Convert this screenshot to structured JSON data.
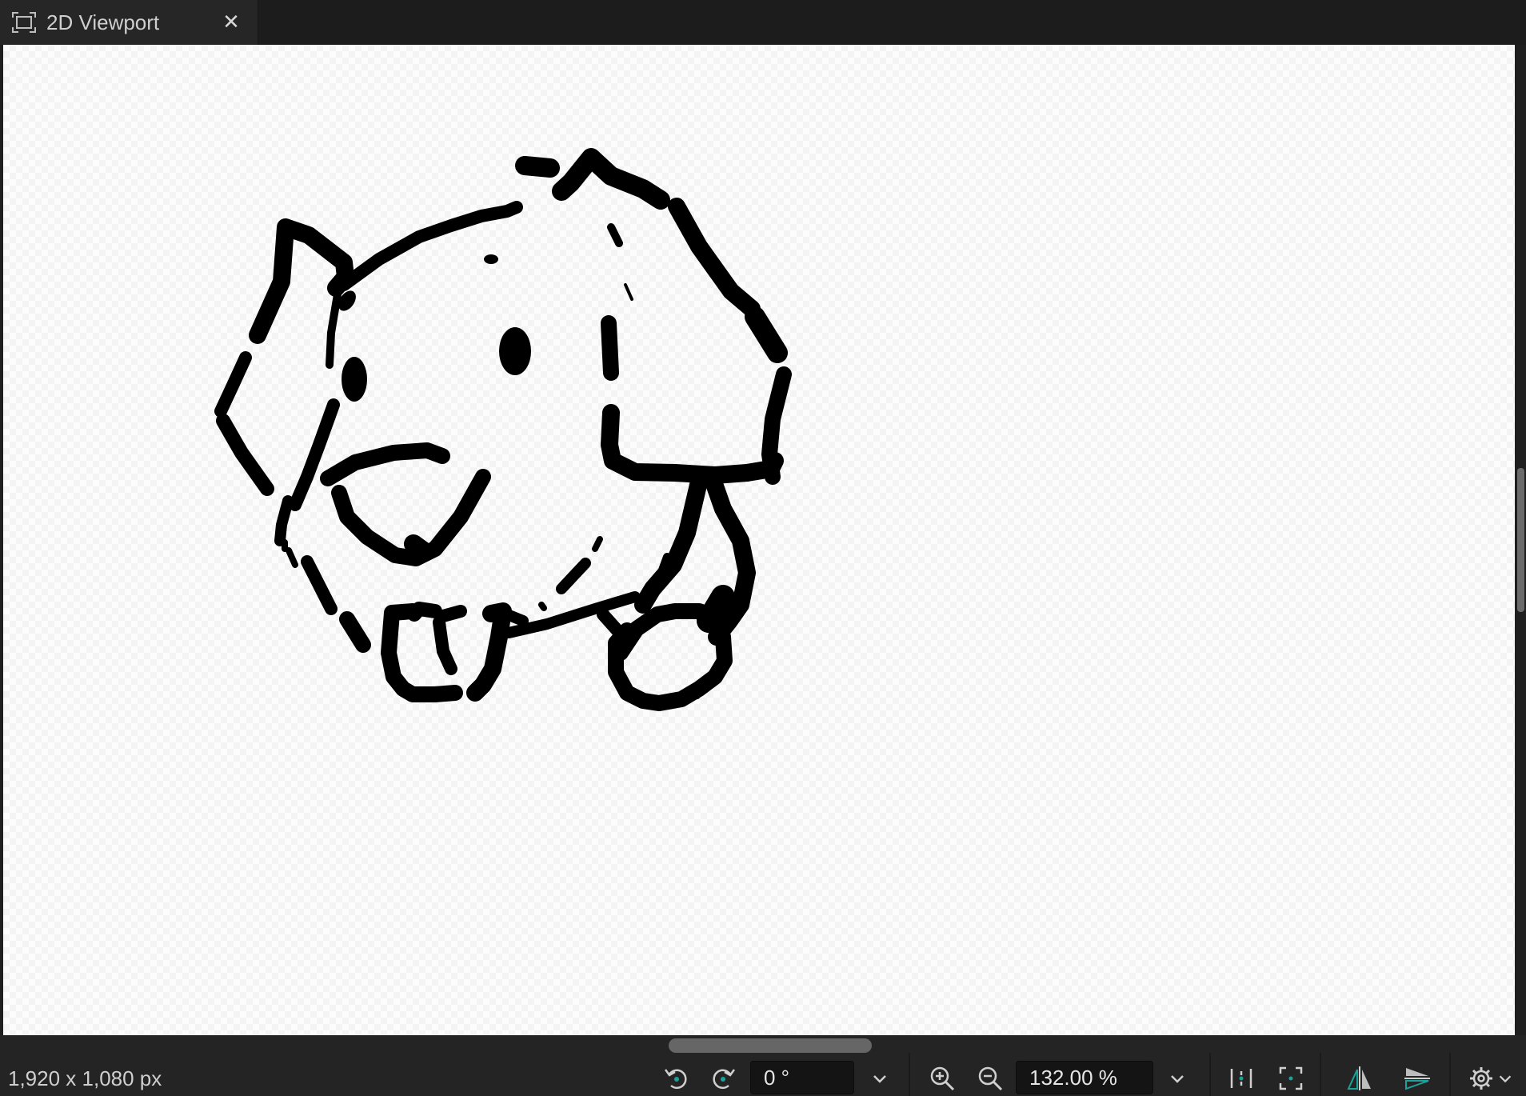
{
  "tab": {
    "title": "2D Viewport",
    "close_glyph": "✕",
    "icon": "viewport-frame-icon"
  },
  "canvas": {
    "drawing": "black ink sketch of a cartoon elephant-like creature"
  },
  "status": {
    "dimensions": "1,920 x 1,080 px"
  },
  "toolbar": {
    "rotate_ccw_icon": "rotate-counterclockwise-icon",
    "rotate_cw_icon": "rotate-clockwise-icon",
    "rotation_value": "0 °",
    "rotation_dropdown_icon": "chevron-down-icon",
    "zoom_in_icon": "zoom-in-icon",
    "zoom_out_icon": "zoom-out-icon",
    "zoom_value": "132.00 %",
    "zoom_dropdown_icon": "chevron-down-icon",
    "fit_width_icon": "fit-width-icon",
    "fit_view_icon": "fit-view-icon",
    "flip_horizontal_icon": "flip-horizontal-icon",
    "flip_vertical_icon": "flip-vertical-icon",
    "settings_icon": "gear-icon",
    "settings_dropdown_icon": "chevron-down-icon"
  },
  "colors": {
    "accent_teal": "#1aa39a",
    "chrome_dark": "#242424",
    "ink": "#000000"
  }
}
